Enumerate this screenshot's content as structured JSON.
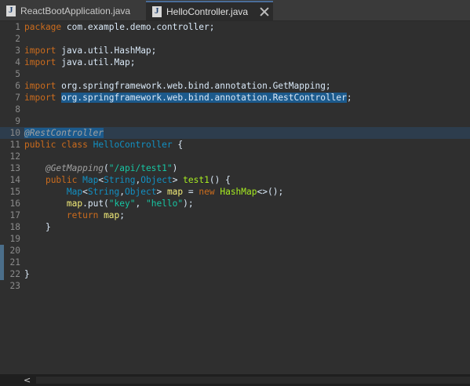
{
  "tabs": [
    {
      "label": "ReactBootApplication.java",
      "active": false
    },
    {
      "label": "HelloController.java",
      "active": true
    }
  ],
  "editor": {
    "lines": [
      {
        "n": "1",
        "tokens": [
          [
            "kw",
            "package"
          ],
          [
            "pln",
            " com.example.demo.controller;"
          ]
        ]
      },
      {
        "n": "2",
        "tokens": []
      },
      {
        "n": "3",
        "tokens": [
          [
            "kw",
            "import"
          ],
          [
            "pln",
            " java.util.HashMap;"
          ]
        ]
      },
      {
        "n": "4",
        "tokens": [
          [
            "kw",
            "import"
          ],
          [
            "pln",
            " java.util.Map;"
          ]
        ]
      },
      {
        "n": "5",
        "tokens": []
      },
      {
        "n": "6",
        "tokens": [
          [
            "kw",
            "import"
          ],
          [
            "pln",
            " org.springframework.web.bind.annotation.GetMapping;"
          ]
        ]
      },
      {
        "n": "7",
        "tokens": [
          [
            "kw",
            "import"
          ],
          [
            "pln",
            " "
          ],
          [
            "sel",
            "org.springframework.web.bind.annotation.RestController"
          ],
          [
            "pln",
            ";"
          ]
        ]
      },
      {
        "n": "8",
        "tokens": []
      },
      {
        "n": "9",
        "tokens": []
      },
      {
        "n": "10",
        "tokens": [
          [
            "selAnn",
            "@RestController"
          ]
        ],
        "highlight": true
      },
      {
        "n": "11",
        "tokens": [
          [
            "kw",
            "public"
          ],
          [
            "pln",
            " "
          ],
          [
            "kw",
            "class"
          ],
          [
            "pln",
            " "
          ],
          [
            "cls",
            "HelloController"
          ],
          [
            "pln",
            " {"
          ]
        ]
      },
      {
        "n": "12",
        "tokens": []
      },
      {
        "n": "13",
        "tokens": [
          [
            "pln",
            "    "
          ],
          [
            "ann",
            "@GetMapping"
          ],
          [
            "pln",
            "("
          ],
          [
            "str",
            "\"/api/test1\""
          ],
          [
            "pln",
            ")"
          ]
        ]
      },
      {
        "n": "14",
        "tokens": [
          [
            "pln",
            "    "
          ],
          [
            "kw",
            "public"
          ],
          [
            "pln",
            " "
          ],
          [
            "typ",
            "Map"
          ],
          [
            "pln",
            "<"
          ],
          [
            "typ",
            "String"
          ],
          [
            "pln",
            ","
          ],
          [
            "typ",
            "Object"
          ],
          [
            "pln",
            "> "
          ],
          [
            "mth",
            "test1"
          ],
          [
            "pln",
            "() {"
          ]
        ]
      },
      {
        "n": "15",
        "tokens": [
          [
            "pln",
            "        "
          ],
          [
            "typ",
            "Map"
          ],
          [
            "pln",
            "<"
          ],
          [
            "typ",
            "String"
          ],
          [
            "pln",
            ","
          ],
          [
            "typ",
            "Object"
          ],
          [
            "pln",
            "> "
          ],
          [
            "var",
            "map"
          ],
          [
            "pln",
            " = "
          ],
          [
            "kw",
            "new"
          ],
          [
            "pln",
            " "
          ],
          [
            "mth",
            "HashMap"
          ],
          [
            "pln",
            "<>();"
          ]
        ]
      },
      {
        "n": "16",
        "tokens": [
          [
            "pln",
            "        "
          ],
          [
            "var",
            "map"
          ],
          [
            "pln",
            ".put("
          ],
          [
            "str",
            "\"key\""
          ],
          [
            "pln",
            ", "
          ],
          [
            "str",
            "\"hello\""
          ],
          [
            "pln",
            ");"
          ]
        ]
      },
      {
        "n": "17",
        "tokens": [
          [
            "pln",
            "        "
          ],
          [
            "kw",
            "return"
          ],
          [
            "pln",
            " "
          ],
          [
            "var",
            "map"
          ],
          [
            "pln",
            ";"
          ]
        ]
      },
      {
        "n": "18",
        "tokens": [
          [
            "pln",
            "    }"
          ]
        ]
      },
      {
        "n": "19",
        "tokens": []
      },
      {
        "n": "20",
        "tokens": []
      },
      {
        "n": "21",
        "tokens": []
      },
      {
        "n": "22",
        "tokens": [
          [
            "pln",
            "}"
          ]
        ]
      },
      {
        "n": "23",
        "tokens": []
      }
    ]
  },
  "scrollbar": {
    "left_arrow": "<"
  }
}
